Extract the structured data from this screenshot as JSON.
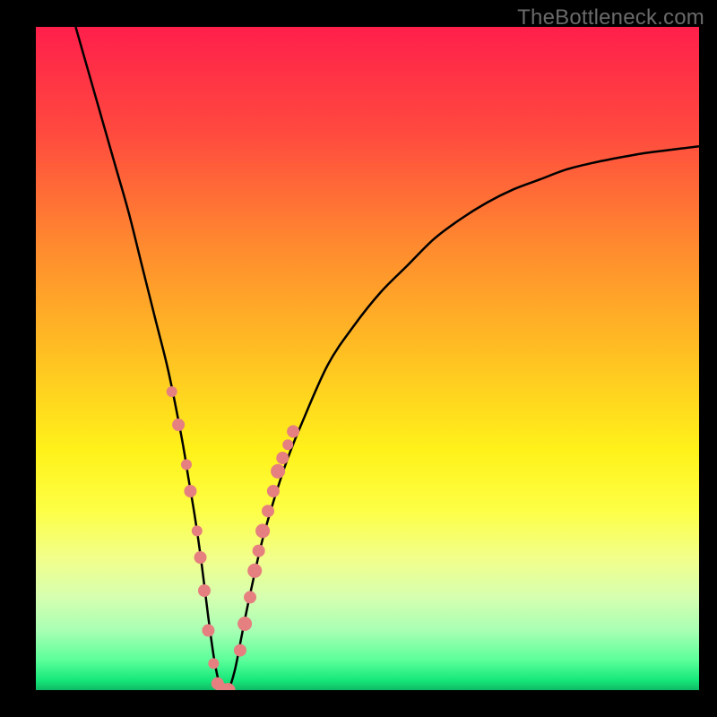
{
  "watermark": "TheBottleneck.com",
  "chart_data": {
    "type": "line",
    "title": "",
    "xlabel": "",
    "ylabel": "",
    "xlim": [
      0,
      100
    ],
    "ylim": [
      0,
      100
    ],
    "curve": {
      "x": [
        6,
        8,
        10,
        12,
        14,
        16,
        18,
        20,
        22,
        23,
        24,
        25,
        26,
        27,
        28,
        29,
        30,
        31,
        32,
        34,
        36,
        38,
        40,
        44,
        48,
        52,
        56,
        60,
        64,
        68,
        72,
        76,
        80,
        84,
        88,
        92,
        96,
        100
      ],
      "y": [
        100,
        93,
        86,
        79,
        72,
        64,
        56,
        48,
        38,
        32,
        26,
        19,
        11,
        4,
        0,
        0,
        3,
        8,
        13,
        22,
        29,
        35,
        40,
        49,
        55,
        60,
        64,
        68,
        71,
        73.5,
        75.5,
        77,
        78.5,
        79.5,
        80.3,
        81,
        81.5,
        82
      ]
    },
    "dots": {
      "x": [
        20.5,
        21.5,
        22.7,
        23.3,
        24.3,
        24.8,
        25.4,
        26.0,
        26.8,
        27.4,
        28.2,
        29.0,
        30.8,
        31.5,
        32.3,
        33.0,
        33.6,
        34.2,
        35.0,
        35.8,
        36.5,
        37.2,
        38.0,
        38.8
      ],
      "y": [
        45,
        40,
        34,
        30,
        24,
        20,
        15,
        9,
        4,
        1,
        0,
        0,
        6,
        10,
        14,
        18,
        21,
        24,
        27,
        30,
        33,
        35,
        37,
        39
      ],
      "r": [
        6,
        7,
        6,
        7,
        6,
        7,
        7,
        7,
        6,
        7,
        8,
        8,
        7,
        8,
        7,
        8,
        7,
        8,
        7,
        7,
        8,
        7,
        6,
        7
      ]
    },
    "gradient_stops": [
      {
        "offset": 0.0,
        "color": "#ff1f4b"
      },
      {
        "offset": 0.16,
        "color": "#ff4a3f"
      },
      {
        "offset": 0.33,
        "color": "#ff8a2f"
      },
      {
        "offset": 0.5,
        "color": "#ffc222"
      },
      {
        "offset": 0.64,
        "color": "#fff21a"
      },
      {
        "offset": 0.73,
        "color": "#fdff46"
      },
      {
        "offset": 0.8,
        "color": "#f2ff8a"
      },
      {
        "offset": 0.86,
        "color": "#d6ffb0"
      },
      {
        "offset": 0.91,
        "color": "#a8ffb4"
      },
      {
        "offset": 0.955,
        "color": "#5bff9a"
      },
      {
        "offset": 0.985,
        "color": "#17e87a"
      },
      {
        "offset": 1.0,
        "color": "#0fb964"
      }
    ],
    "dot_color": "#e67f7f"
  }
}
